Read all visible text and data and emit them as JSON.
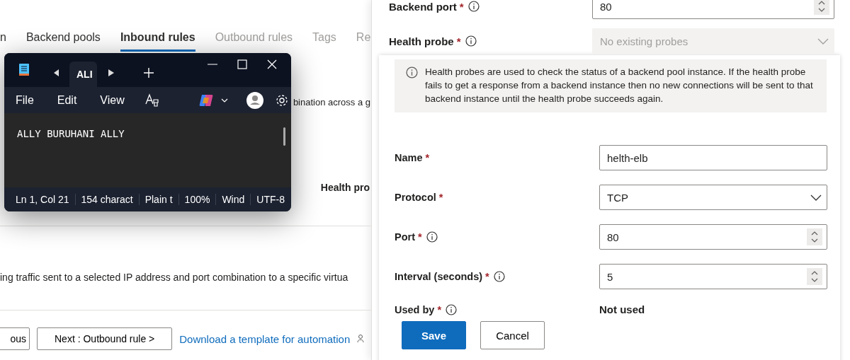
{
  "background_page": {
    "tabs": [
      {
        "label": "n",
        "selected": false,
        "disabled": false
      },
      {
        "label": "Backend pools",
        "selected": false,
        "disabled": false
      },
      {
        "label": "Inbound rules",
        "selected": true,
        "disabled": false
      },
      {
        "label": "Outbound rules",
        "selected": false,
        "disabled": true
      },
      {
        "label": "Tags",
        "selected": false,
        "disabled": true
      },
      {
        "label": "Re",
        "selected": false,
        "disabled": true
      }
    ],
    "intro_fragment": "bination across a g",
    "column_header": "Health pro",
    "description": "ing traffic sent to a selected IP address and port combination to a specific virtua",
    "buttons": [
      {
        "label": "ous"
      },
      {
        "label": "Next : Outbound rule >"
      }
    ],
    "link": "Download a template for automation"
  },
  "notepad": {
    "tab_title": "ALI",
    "menu": [
      "File",
      "Edit",
      "View"
    ],
    "content": "ALLY BURUHANI ALLY",
    "status_bar": [
      "Ln 1, Col 21",
      "154 charact",
      "Plain t",
      "100%",
      "Wind",
      "UTF-8"
    ]
  },
  "side_pane": {
    "fields": [
      {
        "kind": "number",
        "label": "Backend port",
        "required_mark": "*",
        "info": true,
        "value": "80"
      },
      {
        "kind": "dropdown",
        "label": "Health probe",
        "required_mark": "*",
        "info": true,
        "placeholder": "No existing probes",
        "disabled": true
      }
    ]
  },
  "probe_dialog": {
    "info_message": "Health probes are used to check the status of a backend pool instance. If the health probe fails to get a response from a backend instance then no new connections will be sent to that backend instance until the health probe succeeds again.",
    "fields": [
      {
        "kind": "text",
        "label": "Name",
        "required_mark": "*",
        "info": false,
        "value": "helth-elb"
      },
      {
        "kind": "dropdown",
        "label": "Protocol",
        "required_mark": "*",
        "info": false,
        "value": "TCP",
        "disabled": false
      },
      {
        "kind": "number",
        "label": "Port",
        "required_mark": "*",
        "info": true,
        "value": "80"
      },
      {
        "kind": "number",
        "label": "Interval (seconds)",
        "required_mark": "*",
        "info": true,
        "value": "5"
      },
      {
        "kind": "readonly",
        "label": "Used by",
        "required_mark": "*",
        "info": true,
        "value": "Not used"
      }
    ],
    "buttons": [
      {
        "label": "Save",
        "primary": true
      },
      {
        "label": "Cancel",
        "primary": false
      }
    ]
  }
}
